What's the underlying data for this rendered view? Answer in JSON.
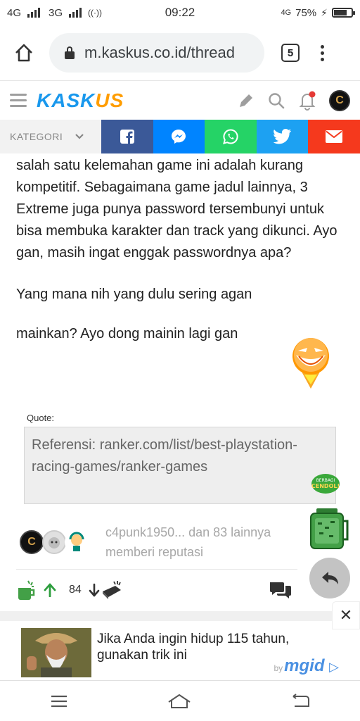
{
  "status": {
    "network_left": "4G",
    "network_right": "3G",
    "time": "09:22",
    "battery_network": "4G",
    "battery_percent": "75%",
    "battery_level": 0.75
  },
  "browser": {
    "url": "m.kaskus.co.id/thread",
    "tab_count": "5"
  },
  "header": {
    "logo_part1": "KASK",
    "logo_part2": "US"
  },
  "share_bar": {
    "kategori_label": "KATEGORI",
    "buttons": [
      {
        "name": "facebook",
        "color": "#3b5998"
      },
      {
        "name": "messenger",
        "color": "#0084ff"
      },
      {
        "name": "whatsapp",
        "color": "#25d366"
      },
      {
        "name": "twitter",
        "color": "#1da1f2"
      },
      {
        "name": "email",
        "color": "#f5391d"
      }
    ]
  },
  "article": {
    "paragraph1": "salah satu kelemahan game ini adalah kurang kompetitif. Sebagaimana game jadul lainnya, 3 Extreme juga punya password tersembunyi untuk bisa membuka karakter dan track yang dikunci. Ayo gan, masih ingat enggak passwordnya apa?",
    "paragraph2": "Yang mana nih yang dulu sering agan",
    "paragraph3": "mainkan? Ayo dong mainin lagi gan",
    "quote_label": "Quote:",
    "quote_text": "Referensi: ranker.com/list/best-playstation-racing-games/ranker-games"
  },
  "cendol": {
    "badge_line1": "BERBAGI",
    "badge_line2": "CENDOL!"
  },
  "reputation": {
    "text_line1": "c4punk1950... dan 83 lainnya",
    "text_line2": "memberi reputasi"
  },
  "actions": {
    "vote_count": "84"
  },
  "ad": {
    "title": "Jika Anda ingin hidup 115 tahun, gunakan trik ini",
    "by_label": "by",
    "brand": "mgid"
  }
}
